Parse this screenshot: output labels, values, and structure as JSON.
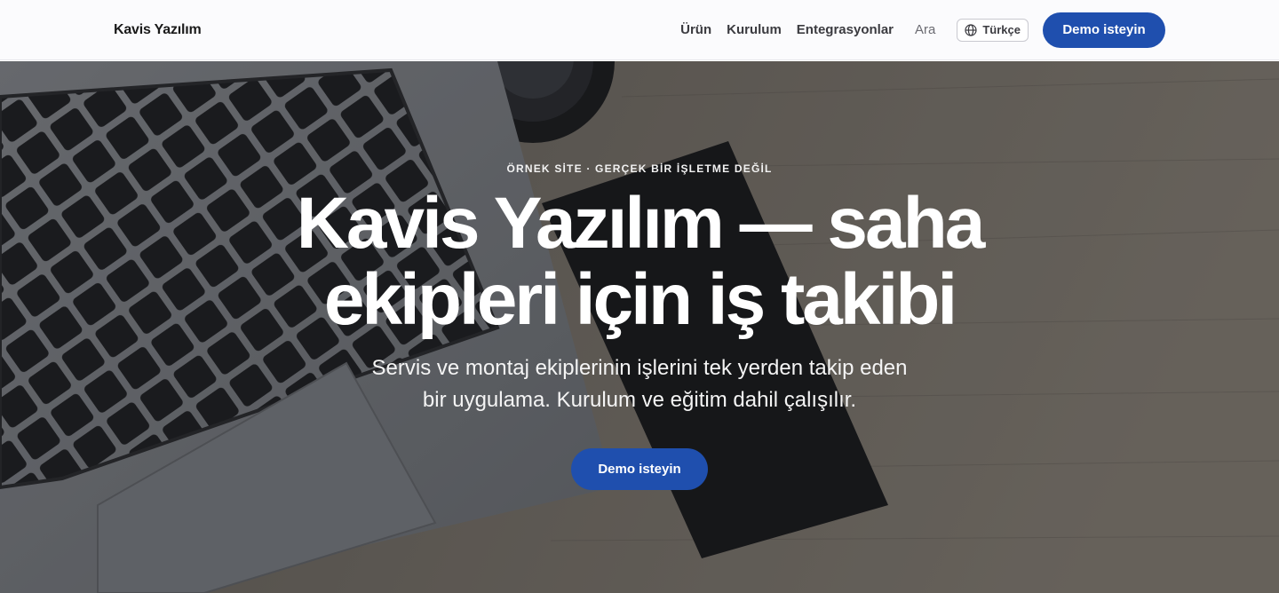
{
  "header": {
    "brand": "Kavis Yazılım",
    "nav": [
      "Ürün",
      "Kurulum",
      "Entegrasyonlar"
    ],
    "search_label": "Ara",
    "language": "Türkçe",
    "cta_label": "Demo isteyin"
  },
  "hero": {
    "eyebrow": "ÖRNEK SİTE · GERÇEK BİR İŞLETME DEĞİL",
    "title_line1": "Kavis Yazılım — saha",
    "title_line2": "ekipleri için iş takibi",
    "subtitle_line1": "Servis ve montaj ekiplerinin işlerini tek yerden takip eden",
    "subtitle_line2": "bir uygulama. Kurulum ve eğitim dahil çalışılır.",
    "cta_label": "Demo isteyin"
  },
  "colors": {
    "accent": "#1f4fae",
    "header_bg": "#fbfbfd"
  }
}
